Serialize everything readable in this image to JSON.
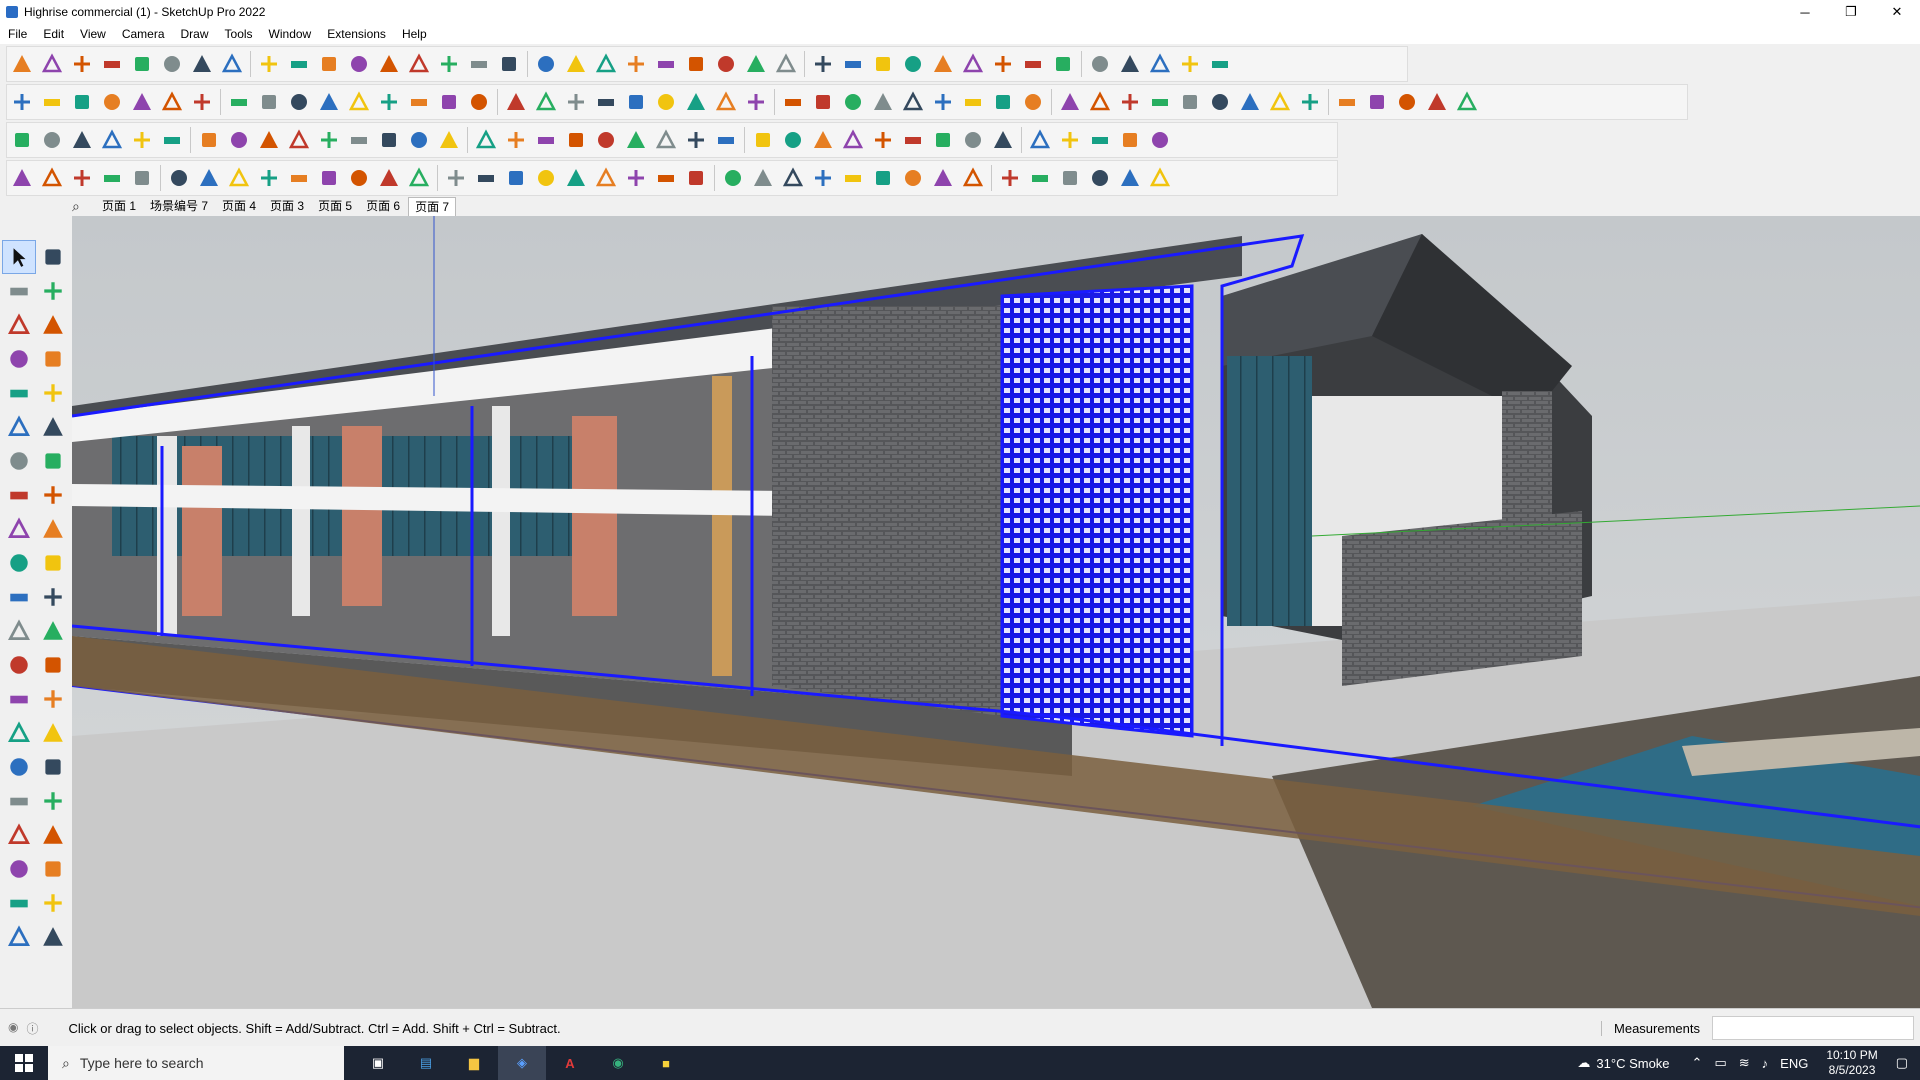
{
  "window": {
    "title": "Highrise commercial (1) - SketchUp Pro 2022",
    "controls": [
      "─",
      "❐",
      "✕"
    ]
  },
  "menu": [
    "File",
    "Edit",
    "View",
    "Camera",
    "Draw",
    "Tools",
    "Window",
    "Extensions",
    "Help"
  ],
  "scenes": {
    "tabs": [
      "页面 1",
      "场景编号 7",
      "页面 4",
      "页面 3",
      "页面 5",
      "页面 6",
      "页面 7"
    ],
    "active_index": 6
  },
  "status": {
    "hint": "Click or drag to select objects. Shift = Add/Subtract. Ctrl = Add. Shift + Ctrl = Subtract.",
    "measurements_label": "Measurements",
    "measurements_value": ""
  },
  "taskbar": {
    "search_placeholder": "Type here to search",
    "weather": "31°C  Smoke",
    "language": "ENG",
    "time": "10:10 PM",
    "date": "8/5/2023"
  },
  "colors": {
    "selection": "#1a1aff",
    "roof": "#4a4d52",
    "floor": "#595959",
    "brick": "#5c5c60",
    "water": "#2f6c86",
    "column": "#c8806a"
  }
}
